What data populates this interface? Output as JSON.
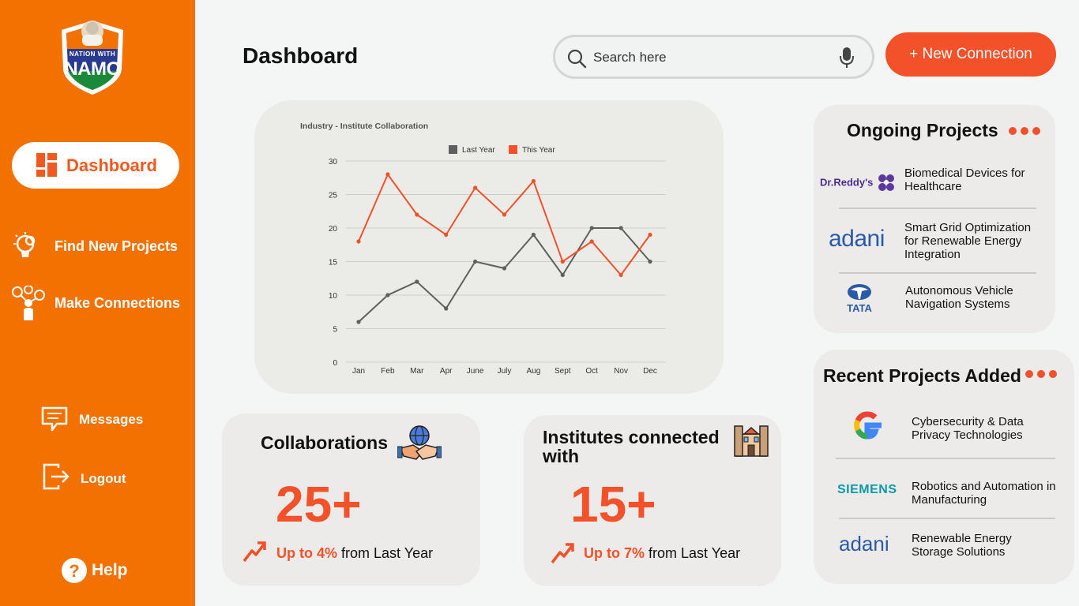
{
  "app": {
    "logo_line1": "NATION WITH",
    "logo_line2": "NAMO"
  },
  "sidebar": {
    "active_item": "Dashboard",
    "items": [
      {
        "label": "Find New Projects",
        "icon": "lightbulb-gear-icon"
      },
      {
        "label": "Make Connections",
        "icon": "network-people-icon"
      },
      {
        "label": "Messages",
        "icon": "message-icon"
      },
      {
        "label": "Logout",
        "icon": "logout-icon"
      }
    ],
    "help_label": "Help"
  },
  "header": {
    "title": "Dashboard",
    "search_placeholder": "Search here",
    "new_connection_label": "+ New Connection"
  },
  "chart_data": {
    "type": "line",
    "title": "Industry - Institute Collaboration",
    "categories": [
      "Jan",
      "Feb",
      "Mar",
      "Apr",
      "June",
      "July",
      "Aug",
      "Sept",
      "Oct",
      "Nov",
      "Dec"
    ],
    "series": [
      {
        "name": "Last Year",
        "color": "#5f5f5f",
        "values": [
          6,
          10,
          12,
          8,
          15,
          14,
          19,
          13,
          20,
          20,
          15
        ]
      },
      {
        "name": "This Year",
        "color": "#f2512a",
        "values": [
          18,
          28,
          22,
          19,
          26,
          22,
          27,
          15,
          18,
          13,
          19
        ]
      }
    ],
    "ylim": [
      0,
      30
    ],
    "yticks": [
      0,
      5,
      10,
      15,
      20,
      25,
      30
    ],
    "grid": true,
    "legend": "top"
  },
  "stats": {
    "collaborations": {
      "title": "Collaborations",
      "value": "25+",
      "trend_highlight": "Up to 4%",
      "trend_rest": "from  Last Year"
    },
    "institutes": {
      "title": "Institutes connected with",
      "value": "15+",
      "trend_highlight": "Up to 7%",
      "trend_rest": "from  Last Year"
    }
  },
  "ongoing": {
    "title": "Ongoing Projects",
    "items": [
      {
        "company": "Dr.Reddy's",
        "project": "Biomedical Devices for Healthcare"
      },
      {
        "company": "adani",
        "project": "Smart Grid Optimization for Renewable Energy Integration"
      },
      {
        "company": "TATA",
        "project": "Autonomous Vehicle Navigation Systems"
      }
    ]
  },
  "recent": {
    "title": "Recent Projects Added",
    "items": [
      {
        "company": "G",
        "project": "Cybersecurity & Data Privacy Technologies"
      },
      {
        "company": "SIEMENS",
        "project": "Robotics and Automation in Manufacturing"
      },
      {
        "company": "adani",
        "project": "Renewable Energy Storage Solutions"
      }
    ]
  },
  "colors": {
    "sidebar": "#f27100",
    "accent": "#f2512a",
    "card": "#ecebea"
  }
}
